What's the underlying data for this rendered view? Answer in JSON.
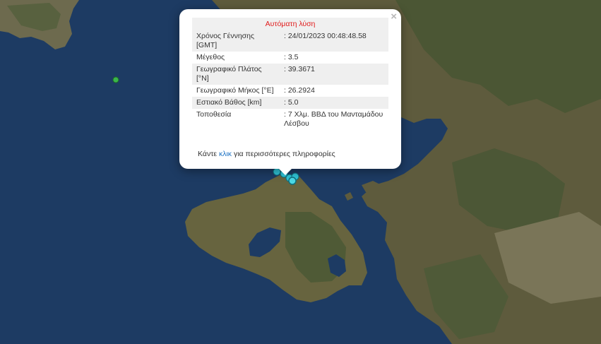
{
  "popup": {
    "title": "Αυτόματη λύση",
    "close_label": "×",
    "rows": [
      {
        "label": "Χρόνος Γέννησης [GMT]",
        "value": ": 24/01/2023 00:48:48.58"
      },
      {
        "label": "Μέγεθος",
        "value": ": 3.5"
      },
      {
        "label": "Γεωγραφικό Πλάτος [°N]",
        "value": ": 39.3671"
      },
      {
        "label": "Γεωγραφικό Μήκος [°E]",
        "value": ": 26.2924"
      },
      {
        "label": "Εστιακό Βάθος [km]",
        "value": ": 5.0"
      },
      {
        "label": "Τοποθεσία",
        "value": ": 7 Χλμ. ΒΒΔ του Μανταμάδου Λέσβου"
      }
    ],
    "footer_before": "Κάντε ",
    "footer_link": "κλικ",
    "footer_after": " για περισσότερες πληροφορίες"
  },
  "colors": {
    "sea": "#1c3a63",
    "land": "#5b5a3a",
    "title_red": "#e01b1b",
    "link": "#1e73c4",
    "quake_marker": "#2fc3d6",
    "green_marker": "#3ab54a"
  }
}
